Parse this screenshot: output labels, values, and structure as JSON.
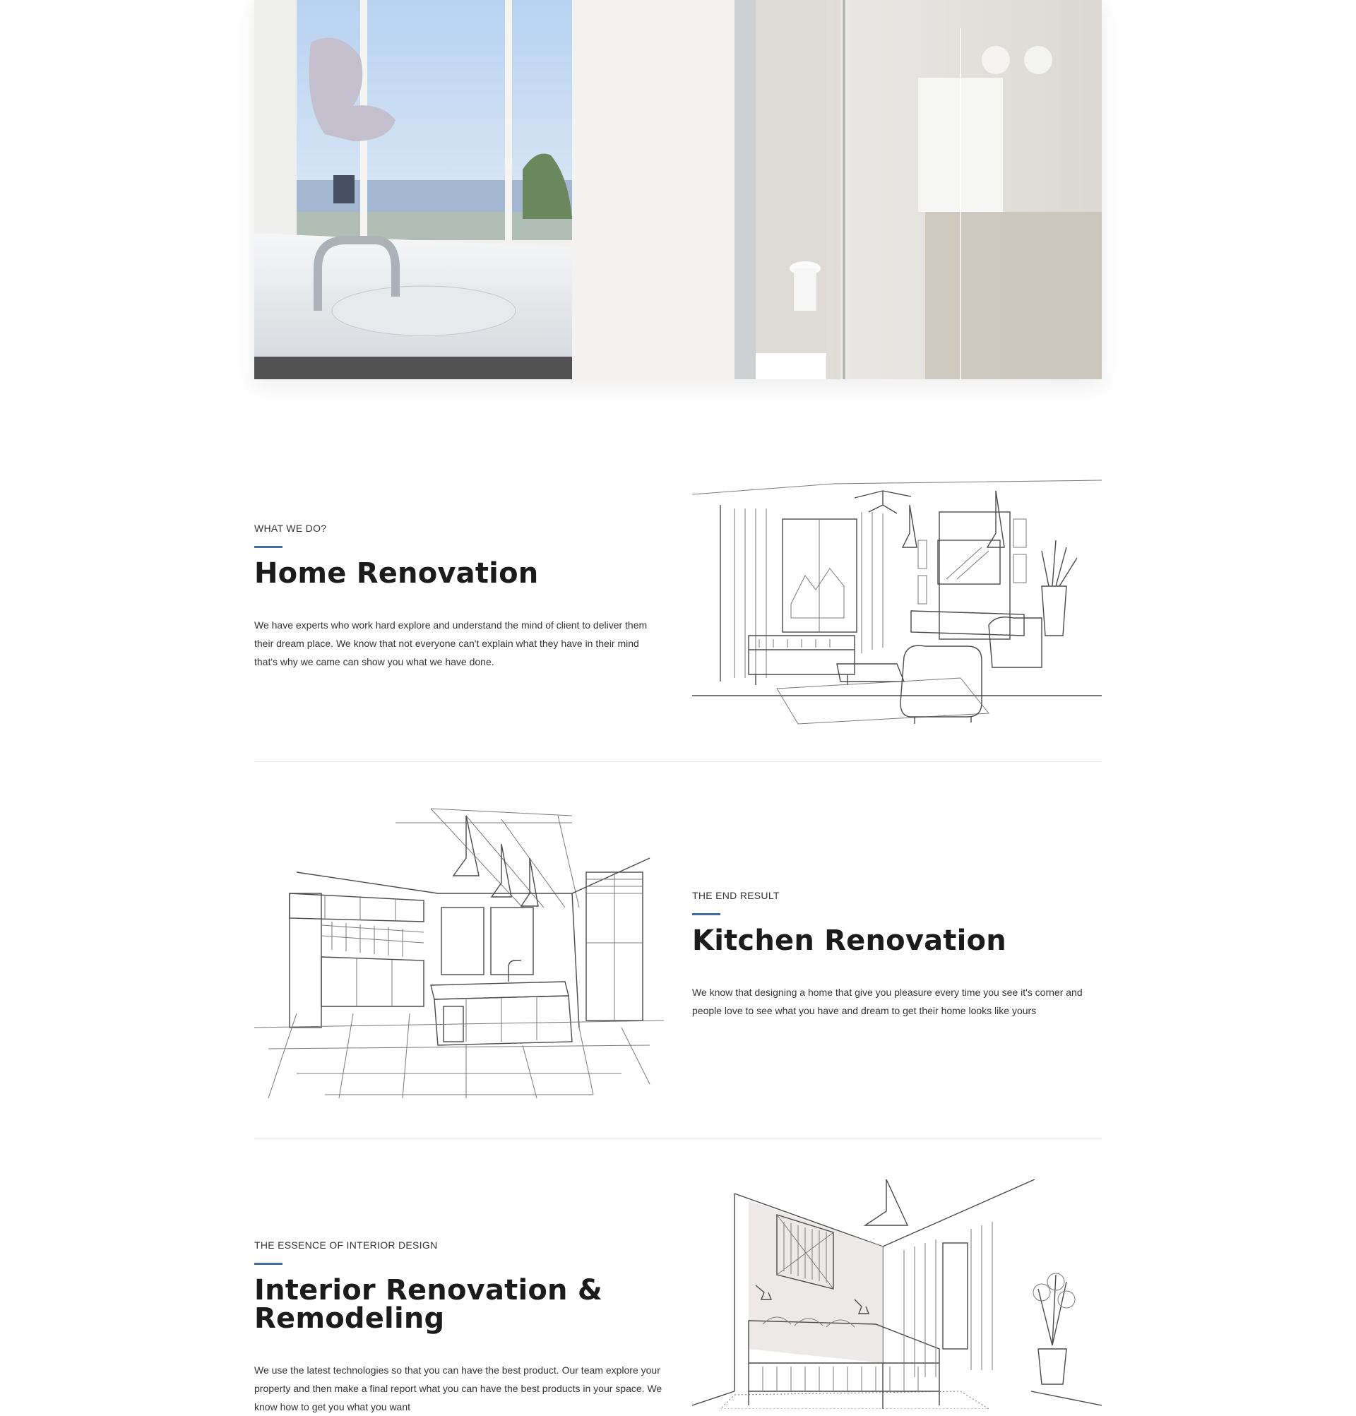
{
  "hero": {
    "image_alt": "Bright modern kitchen and bathroom interior"
  },
  "sections": [
    {
      "eyebrow": "WHAT WE DO?",
      "title": "Home Renovation",
      "text": "We have experts who work hard explore and understand the mind of client to deliver them their dream place. We know that not everyone can't explain what they have in their mind that's why we came can show you what we have done.",
      "image_alt": "Living room sketch illustration"
    },
    {
      "eyebrow": "THE END RESULT",
      "title": "Kitchen Renovation",
      "text": "We know that designing a home that give you pleasure every time you see it's corner and people love to see what you have and dream to get their home looks like yours",
      "image_alt": "Kitchen sketch illustration"
    },
    {
      "eyebrow": "THE ESSENCE OF INTERIOR DESIGN",
      "title": "Interior Renovation & Remodeling",
      "text": "We use the latest technologies so that you can have the best product. Our team explore your property and then make a final report what you can have the best products in your space. We know how to get you what you want",
      "image_alt": "Bedroom sketch illustration"
    }
  ],
  "colors": {
    "accent": "#3e6ea7",
    "heading": "#1b1b1b",
    "body_text": "#333333",
    "divider": "#e6e6e6"
  }
}
